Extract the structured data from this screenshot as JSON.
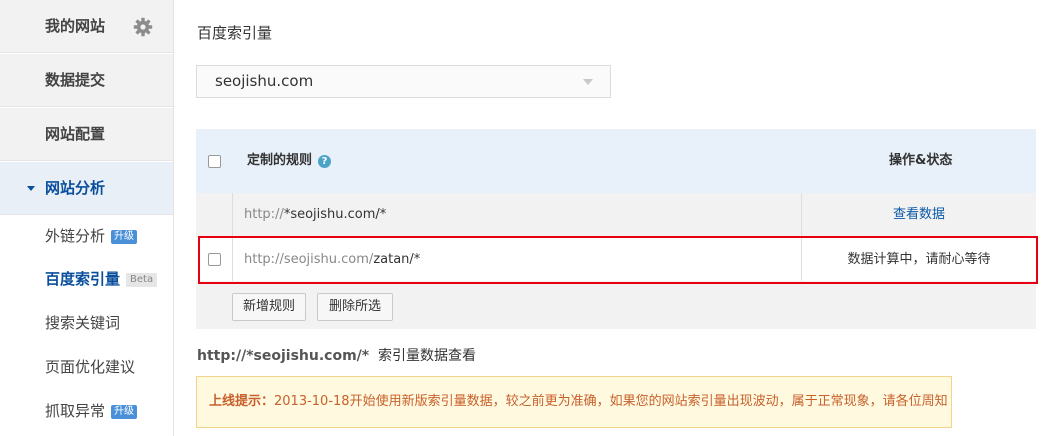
{
  "sidebar": {
    "my_site": "我的网站",
    "data_submit": "数据提交",
    "site_config": "网站配置",
    "site_analysis": "网站分析",
    "sub_items": {
      "external_links": "外链分析",
      "baidu_index": "百度索引量",
      "search_keywords": "搜索关键词",
      "page_optimization": "页面优化建议",
      "crawl_errors": "抓取异常"
    },
    "badge_upgrade": "升级",
    "badge_beta": "Beta"
  },
  "main": {
    "title": "百度索引量",
    "site_select": {
      "value": "seojishu.com"
    },
    "rules": {
      "header_rule": "定制的规则",
      "header_op": "操作&状态",
      "rows": [
        {
          "url_prefix": "http://",
          "url_main": "*seojishu.com/*",
          "op": "查看数据"
        },
        {
          "url_prefix": "http://seojishu.com/",
          "url_main": "zatan/*",
          "op": "数据计算中，请耐心等待"
        }
      ],
      "add_button": "新增规则",
      "delete_button": "删除所选"
    },
    "index_title": {
      "url": "http://*seojishu.com/*",
      "text": "索引量数据查看"
    },
    "notice": {
      "label": "上线提示：",
      "text": "2013-10-18开始使用新版索引量数据，较之前更为准确，如果您的网站索引量出现波动，属于正常现象，请各位周知"
    }
  },
  "colors": {
    "accent": "#0a4f9c",
    "highlight_border": "#e60012",
    "notice_text": "#c8602a",
    "badge": "#4a90d9"
  }
}
